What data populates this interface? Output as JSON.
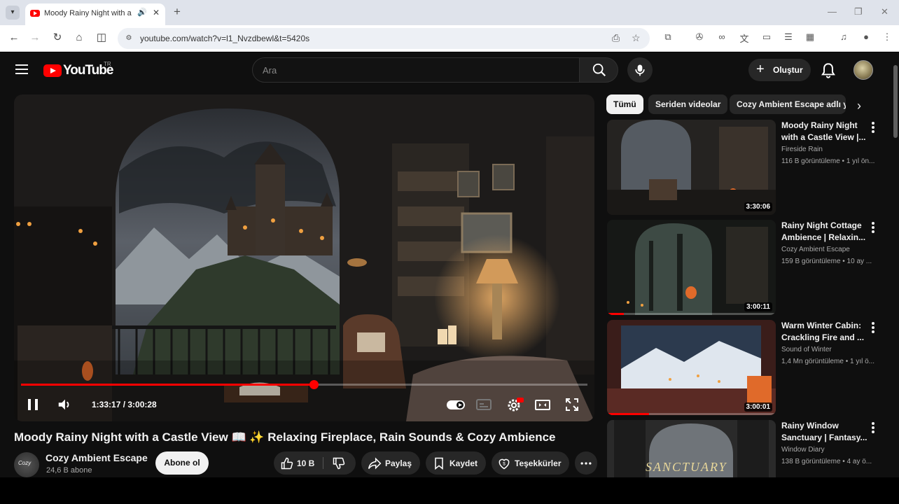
{
  "browser": {
    "tab_title": "Moody Rainy Night with a Castle View",
    "url": "youtube.com/watch?v=l1_Nvzdbewl&t=5420s"
  },
  "header": {
    "logo_text": "YouTube",
    "logo_country": "TR",
    "search_placeholder": "Ara",
    "create_label": "Oluştur"
  },
  "player": {
    "time_current": "1:33:17",
    "time_total": "3:00:28",
    "time_display": "1:33:17 / 3:00:28",
    "progress_fraction": 0.517
  },
  "video": {
    "title": "Moody Rainy Night with a Castle View 📖 ✨ Relaxing Fireplace, Rain Sounds & Cozy Ambience",
    "channel_name": "Cozy Ambient Escape",
    "channel_avatar_text": "Cozy",
    "subscribers": "24,6 B abone",
    "subscribe_label": "Abone ol",
    "likes": "10 B",
    "share_label": "Paylaş",
    "save_label": "Kaydet",
    "thanks_label": "Teşekkürler"
  },
  "chips": [
    "Tümü",
    "Seriden videolar",
    "Cozy Ambient Escape adlı yü"
  ],
  "recommendations": [
    {
      "title": "Moody Rainy Night with a Castle View |...",
      "channel": "Fireside Rain",
      "meta": "116 B görüntüleme • 1 yıl ön...",
      "duration": "3:30:06",
      "watched_fraction": 0
    },
    {
      "title": "Rainy Night Cottage Ambience | Relaxin...",
      "channel": "Cozy Ambient Escape",
      "meta": "159 B görüntüleme • 10 ay ...",
      "duration": "3:00:11",
      "watched_fraction": 0.1
    },
    {
      "title": "Warm Winter Cabin: Crackling Fire and ...",
      "channel": "Sound of Winter",
      "meta": "1,4 Mn görüntüleme • 1 yıl ö...",
      "duration": "3:00:01",
      "watched_fraction": 0.25
    },
    {
      "title": "Rainy Window Sanctuary | Fantasy...",
      "channel": "Window Diary",
      "meta": "138 B görüntüleme • 4 ay ö...",
      "thumb_text": "SANCTUARY",
      "duration": "",
      "watched_fraction": 0
    }
  ],
  "colors": {
    "bg": "#0f0f0f",
    "accent": "#ff0000",
    "pill": "#272727"
  }
}
